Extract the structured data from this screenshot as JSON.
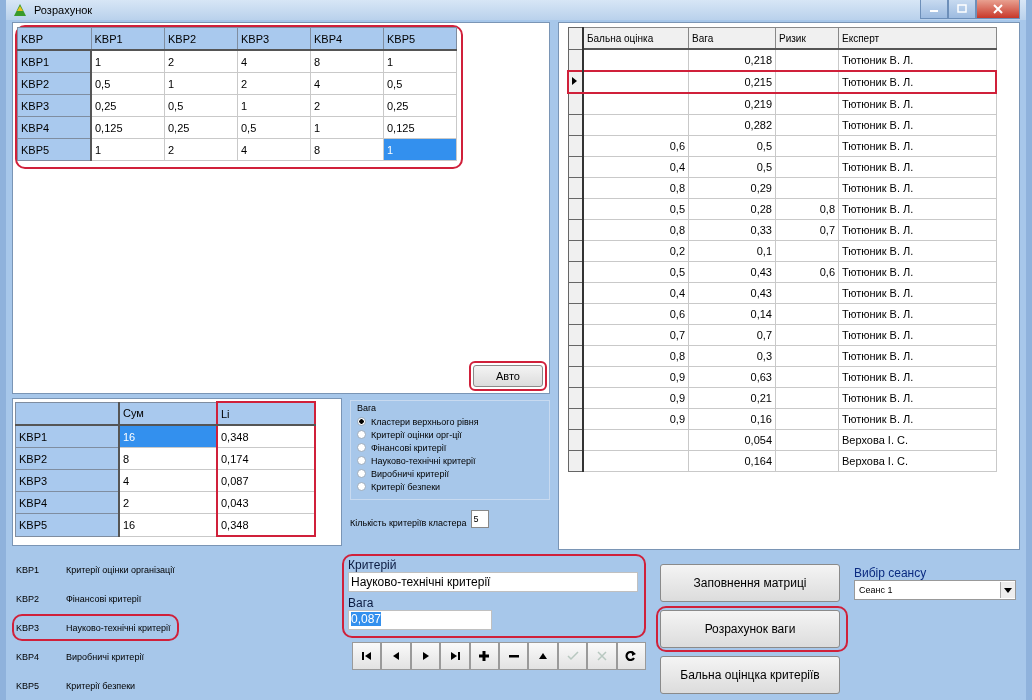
{
  "window": {
    "title": "Розрахунок"
  },
  "matrix": {
    "annotated": true,
    "corner": "KBP",
    "columns": [
      "KBP1",
      "KBP2",
      "KBP3",
      "KBP4",
      "KBP5"
    ],
    "rows": [
      {
        "header": "KBP1",
        "cells": [
          {
            "value": "1",
            "selected": false
          },
          {
            "value": "2",
            "selected": false
          },
          {
            "value": "4",
            "selected": false
          },
          {
            "value": "8",
            "selected": false
          },
          {
            "value": "1",
            "selected": false
          }
        ]
      },
      {
        "header": "KBP2",
        "cells": [
          {
            "value": "0,5",
            "selected": false
          },
          {
            "value": "1",
            "selected": false
          },
          {
            "value": "2",
            "selected": false
          },
          {
            "value": "4",
            "selected": false
          },
          {
            "value": "0,5",
            "selected": false
          }
        ]
      },
      {
        "header": "KBP3",
        "cells": [
          {
            "value": "0,25",
            "selected": false
          },
          {
            "value": "0,5",
            "selected": false
          },
          {
            "value": "1",
            "selected": false
          },
          {
            "value": "2",
            "selected": false
          },
          {
            "value": "0,25",
            "selected": false
          }
        ]
      },
      {
        "header": "KBP4",
        "cells": [
          {
            "value": "0,125",
            "selected": false
          },
          {
            "value": "0,25",
            "selected": false
          },
          {
            "value": "0,5",
            "selected": false
          },
          {
            "value": "1",
            "selected": false
          },
          {
            "value": "0,125",
            "selected": false
          }
        ]
      },
      {
        "header": "KBP5",
        "cells": [
          {
            "value": "1",
            "selected": false
          },
          {
            "value": "2",
            "selected": false
          },
          {
            "value": "4",
            "selected": false
          },
          {
            "value": "8",
            "selected": false
          },
          {
            "value": "1",
            "selected": true
          }
        ]
      }
    ]
  },
  "auto_button": {
    "label": "Авто",
    "annotated": true
  },
  "sums_table": {
    "columns": [
      {
        "label": "Сум",
        "annotated": false
      },
      {
        "label": "Li",
        "annotated": true
      }
    ],
    "rows": [
      {
        "header": "KBP1",
        "cells": [
          {
            "value": "16",
            "selected": true
          },
          {
            "value": "0,348",
            "selected": false
          }
        ]
      },
      {
        "header": "KBP2",
        "cells": [
          {
            "value": "8",
            "selected": false
          },
          {
            "value": "0,174",
            "selected": false
          }
        ]
      },
      {
        "header": "KBP3",
        "cells": [
          {
            "value": "4",
            "selected": false
          },
          {
            "value": "0,087",
            "selected": false
          }
        ]
      },
      {
        "header": "KBP4",
        "cells": [
          {
            "value": "2",
            "selected": false
          },
          {
            "value": "0,043",
            "selected": false
          }
        ]
      },
      {
        "header": "KBP5",
        "cells": [
          {
            "value": "16",
            "selected": false
          },
          {
            "value": "0,348",
            "selected": false
          }
        ]
      }
    ]
  },
  "weight_group": {
    "title": "Вага",
    "options": [
      {
        "label": "Кластери верхнього рівня",
        "selected": true
      },
      {
        "label": "Критерії оцінки орг-ції",
        "selected": false
      },
      {
        "label": "Фінансові критерії",
        "selected": false
      },
      {
        "label": "Науково-технічні критерії",
        "selected": false
      },
      {
        "label": "Виробничі критерії",
        "selected": false
      },
      {
        "label": "Критерії безпеки",
        "selected": false
      }
    ]
  },
  "cluster_count": {
    "label": "Кількість критеріїв кластера",
    "value": "5"
  },
  "legend": [
    {
      "code": "KBP1",
      "name": "Критерії оцінки організації"
    },
    {
      "code": "KBP2",
      "name": "Фінансові критерії"
    },
    {
      "code": "KBP3",
      "name": "Науково-технічні критерії",
      "annotated": true
    },
    {
      "code": "KBP4",
      "name": "Виробничі критерії"
    },
    {
      "code": "KBP5",
      "name": "Критерії безпеки"
    }
  ],
  "criterion_group": {
    "annotated": true,
    "criterion_label": "Критерій",
    "criterion_value": "Науково-технічні критерії",
    "weight_label": "Вага",
    "weight_value": "0,087",
    "weight_selected": true
  },
  "navigator": [
    {
      "kind": "first",
      "disabled": false
    },
    {
      "kind": "prior",
      "disabled": false
    },
    {
      "kind": "next",
      "disabled": false
    },
    {
      "kind": "last",
      "disabled": false
    },
    {
      "kind": "insert",
      "disabled": false
    },
    {
      "kind": "delete",
      "disabled": false
    },
    {
      "kind": "edit",
      "disabled": false
    },
    {
      "kind": "post",
      "disabled": true
    },
    {
      "kind": "cancel",
      "disabled": true
    },
    {
      "kind": "refresh",
      "disabled": false
    }
  ],
  "grid": {
    "columns": [
      "Бальна оцінка",
      "Вага",
      "Ризик",
      "Експерт"
    ],
    "rows": [
      {
        "weight": "0,218",
        "expert": "Тютюник В. Л.",
        "current": false,
        "annotated": false
      },
      {
        "weight": "0,215",
        "expert": "Тютюник В. Л.",
        "current": true,
        "annotated": true
      },
      {
        "weight": "0,219",
        "expert": "Тютюник В. Л.",
        "current": false,
        "annotated": false
      },
      {
        "weight": "0,282",
        "expert": "Тютюник В. Л.",
        "current": false,
        "annotated": false
      },
      {
        "score": "0,6",
        "weight": "0,5",
        "expert": "Тютюник В. Л.",
        "current": false,
        "annotated": false
      },
      {
        "score": "0,4",
        "weight": "0,5",
        "expert": "Тютюник В. Л.",
        "current": false,
        "annotated": false
      },
      {
        "score": "0,8",
        "weight": "0,29",
        "expert": "Тютюник В. Л.",
        "current": false,
        "annotated": false
      },
      {
        "score": "0,5",
        "weight": "0,28",
        "risk": "0,8",
        "expert": "Тютюник В. Л.",
        "current": false,
        "annotated": false
      },
      {
        "score": "0,8",
        "weight": "0,33",
        "risk": "0,7",
        "expert": "Тютюник В. Л.",
        "current": false,
        "annotated": false
      },
      {
        "score": "0,2",
        "weight": "0,1",
        "expert": "Тютюник В. Л.",
        "current": false,
        "annotated": false
      },
      {
        "score": "0,5",
        "weight": "0,43",
        "risk": "0,6",
        "expert": "Тютюник В. Л.",
        "current": false,
        "annotated": false
      },
      {
        "score": "0,4",
        "weight": "0,43",
        "expert": "Тютюник В. Л.",
        "current": false,
        "annotated": false
      },
      {
        "score": "0,6",
        "weight": "0,14",
        "expert": "Тютюник В. Л.",
        "current": false,
        "annotated": false
      },
      {
        "score": "0,7",
        "weight": "0,7",
        "expert": "Тютюник В. Л.",
        "current": false,
        "annotated": false
      },
      {
        "score": "0,8",
        "weight": "0,3",
        "expert": "Тютюник В. Л.",
        "current": false,
        "annotated": false
      },
      {
        "score": "0,9",
        "weight": "0,63",
        "expert": "Тютюник В. Л.",
        "current": false,
        "annotated": false
      },
      {
        "score": "0,9",
        "weight": "0,21",
        "expert": "Тютюник В. Л.",
        "current": false,
        "annotated": false
      },
      {
        "score": "0,9",
        "weight": "0,16",
        "expert": "Тютюник В. Л.",
        "current": false,
        "annotated": false
      },
      {
        "weight": "0,054",
        "expert": "Верхова І. С.",
        "current": false,
        "annotated": false
      },
      {
        "weight": "0,164",
        "expert": "Верхова І. С.",
        "current": false,
        "annotated": false
      }
    ]
  },
  "buttons": [
    {
      "label": "Заповнення матриці",
      "annotated": false
    },
    {
      "label": "Розрахунок ваги",
      "annotated": true
    },
    {
      "label": "Бальна оцінцка критеріїв",
      "annotated": false
    }
  ],
  "session": {
    "label": "Вибір сеансу",
    "value": "Сеанс 1"
  }
}
